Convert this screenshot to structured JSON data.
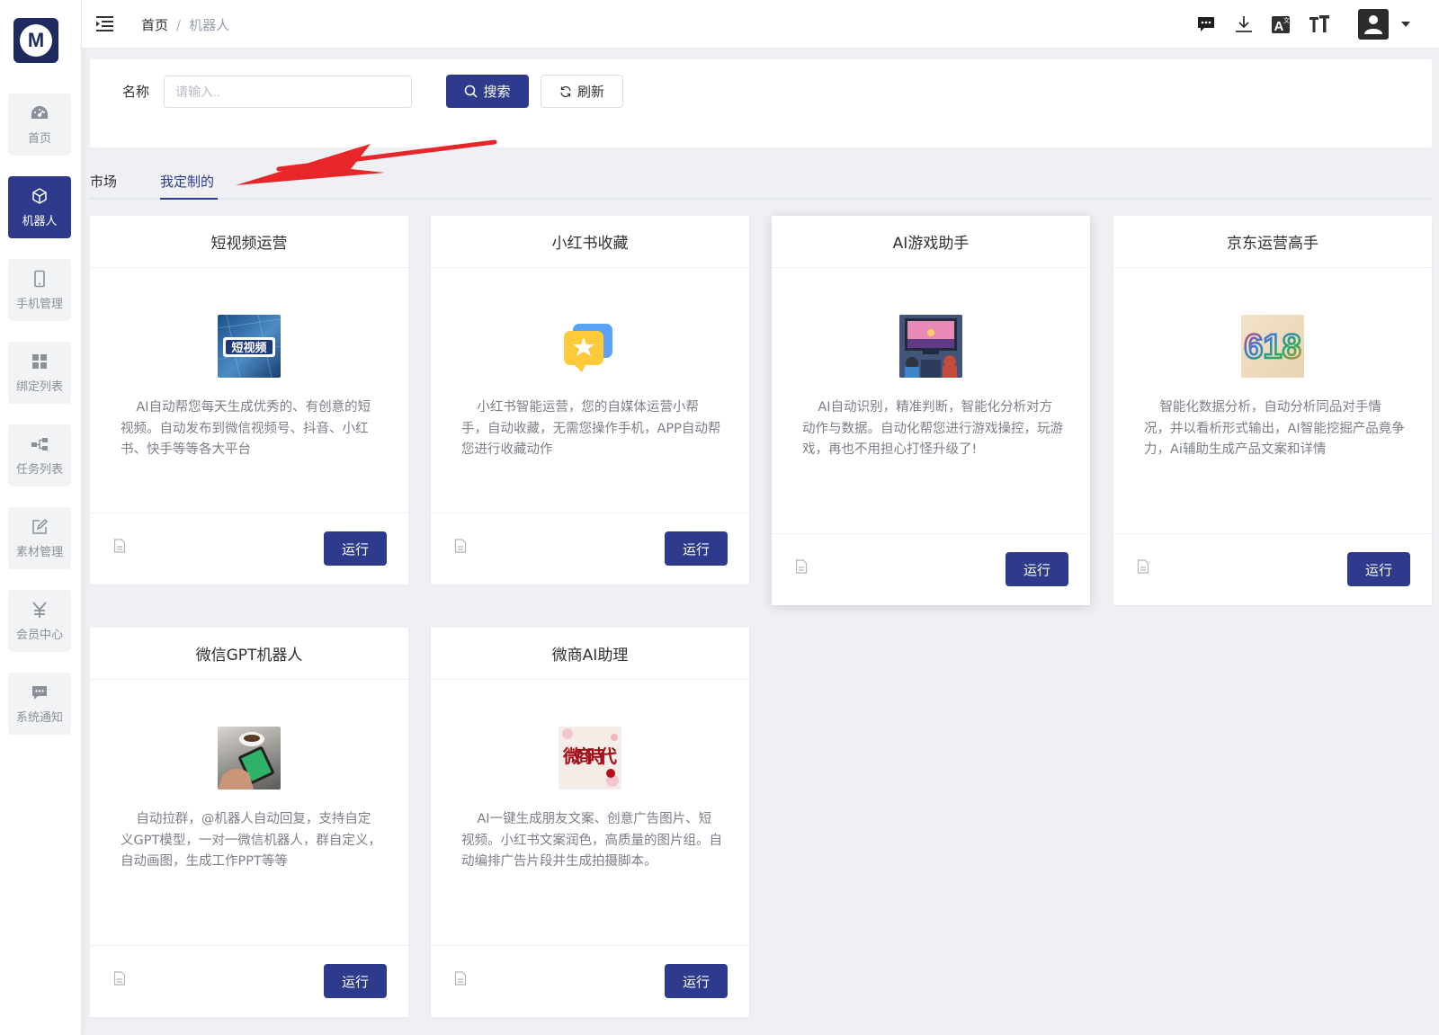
{
  "logo": {
    "letter": "M"
  },
  "sidebar": {
    "items": [
      {
        "label": "首页",
        "icon": "dashboard-icon",
        "active": false
      },
      {
        "label": "机器人",
        "icon": "cube-icon",
        "active": true
      },
      {
        "label": "手机管理",
        "icon": "phone-icon",
        "active": false
      },
      {
        "label": "绑定列表",
        "icon": "grid-icon",
        "active": false
      },
      {
        "label": "任务列表",
        "icon": "flow-icon",
        "active": false
      },
      {
        "label": "素材管理",
        "icon": "edit-icon",
        "active": false
      },
      {
        "label": "会员中心",
        "icon": "yen-icon",
        "active": false
      },
      {
        "label": "系统通知",
        "icon": "message-icon",
        "active": false
      }
    ]
  },
  "header": {
    "breadcrumb": {
      "home": "首页",
      "separator": "/",
      "current": "机器人"
    },
    "icons": [
      "chat-icon",
      "download-icon",
      "translate-icon",
      "font-size-icon",
      "user-avatar-icon"
    ]
  },
  "search": {
    "label": "名称",
    "placeholder": "请输入..",
    "search_button": "搜索",
    "refresh_button": "刷新"
  },
  "tabs": [
    {
      "label": "市场",
      "active": false
    },
    {
      "label": "我定制的",
      "active": true
    }
  ],
  "cards": [
    {
      "title": "短视频运营",
      "image": "short-video-thumbnail",
      "image_text": "短视频",
      "description": "AI自动帮您每天生成优秀的、有创意的短视频。自动发布到微信视频号、抖音、小红书、快手等等各大平台",
      "run_label": "运行"
    },
    {
      "title": "小红书收藏",
      "image": "star-favorite-thumbnail",
      "description": "小红书智能运营，您的自媒体运营小帮手，自动收藏，无需您操作手机，APP自动帮您进行收藏动作",
      "run_label": "运行"
    },
    {
      "title": "AI游戏助手",
      "image": "game-players-thumbnail",
      "description": "AI自动识别，精准判断，智能化分析对方动作与数据。自动化帮您进行游戏操控，玩游戏，再也不用担心打怪升级了!",
      "run_label": "运行"
    },
    {
      "title": "京东运营高手",
      "image": "618-thumbnail",
      "image_text": "618",
      "description": "智能化数据分析，自动分析同品对手情况，并以看析形式输出，AI智能挖掘产品竟争力，Ai辅助生成产品文案和详情",
      "run_label": "运行"
    },
    {
      "title": "微信GPT机器人",
      "image": "phone-coffee-thumbnail",
      "description": "自动拉群，@机器人自动回复，支持自定义GPT模型，一对一微信机器人，群自定义，自动画图，生成工作PPT等等",
      "run_label": "运行"
    },
    {
      "title": "微商AI助理",
      "image": "weishang-calligraphy-thumbnail",
      "image_text": "微商時代",
      "description": "AI一键生成朋友文案、创意广告图片、短视频。小红书文案润色，高质量的图片组。自动编排广告片段并生成拍摄脚本。",
      "run_label": "运行"
    }
  ],
  "colors": {
    "primary": "#2e3a8c",
    "background": "#eef0f4",
    "annotation_arrow": "#e8262a"
  }
}
